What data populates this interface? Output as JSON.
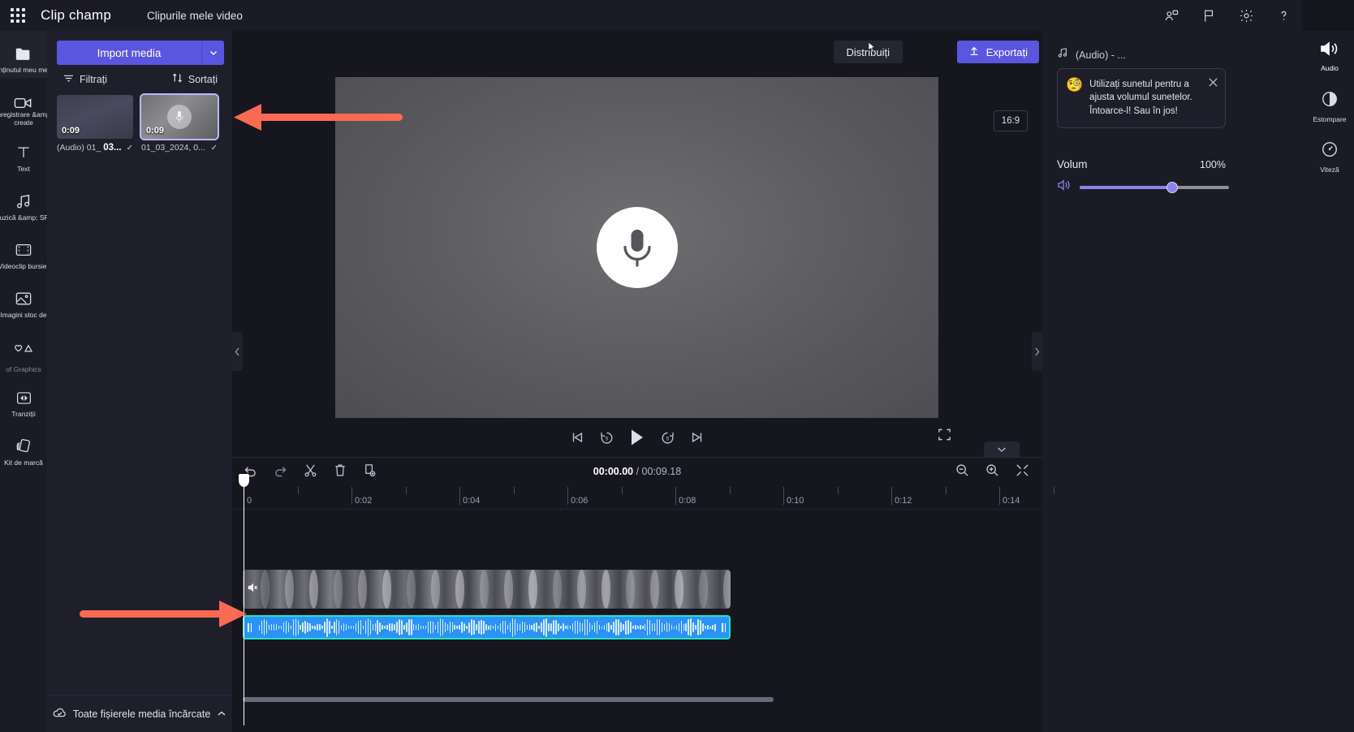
{
  "topbar": {
    "waffle_icon": "app-launcher-icon",
    "brand": "Clip champ",
    "project_name": "Clipurile mele video",
    "icons": [
      {
        "name": "share-person-icon",
        "glyph": "person-share"
      },
      {
        "name": "flag-feedback-icon",
        "glyph": "flag"
      },
      {
        "name": "settings-gear-icon",
        "glyph": "gear"
      },
      {
        "name": "help-question-icon",
        "glyph": "?"
      }
    ]
  },
  "sidebar": {
    "items": [
      {
        "label": "Conținutul meu media",
        "icon": "folder-icon",
        "active": true
      },
      {
        "label": "Înregistrare &amp;\ncreate",
        "icon": "video-camera-icon",
        "active": false
      },
      {
        "label": "Text",
        "icon": "text-t-icon",
        "active": false
      },
      {
        "label": "Muzică &amp; SFX",
        "icon": "music-note-icon",
        "active": false
      },
      {
        "label": "Videoclip bursier",
        "icon": "film-strip-icon",
        "active": false
      },
      {
        "label": "Imagini stoc de",
        "icon": "image-icon",
        "active": false
      },
      {
        "label": "of\nGraphics",
        "icon": "heart-triangle-icon",
        "active": false
      },
      {
        "label": "Tranziții",
        "icon": "transition-icon",
        "active": false
      },
      {
        "label": "Kit de marcă",
        "icon": "brand-cards-icon",
        "active": false
      }
    ]
  },
  "media_panel": {
    "import_label": "Import media",
    "import_caret_icon": "chevron-down-icon",
    "filter_label": "Filtrați",
    "filter_icon": "filter-icon",
    "sort_label": "Sortați",
    "sort_icon": "sort-arrows-icon",
    "items": [
      {
        "duration": "0:09",
        "name_prefix": "(Audio) 01_",
        "name_bold": "03...",
        "kind": "audio",
        "selected": true
      },
      {
        "duration": "0:09",
        "name_prefix": "01_03_2024, 0...",
        "name_bold": "",
        "kind": "video",
        "selected": false
      }
    ],
    "all_media_label": "Toate fișierele media încărcate",
    "all_media_icon": "cloud-check-icon",
    "all_media_caret": "chevron-up-icon"
  },
  "stage": {
    "share_label": "Distribuiți",
    "export_label": "Exportați",
    "export_icon": "upload-icon",
    "aspect_ratio": "16:9",
    "preview_icon": "microphone-icon",
    "transport": [
      {
        "name": "skip-to-start-button",
        "glyph": "|<"
      },
      {
        "name": "rewind-5s-button",
        "glyph": "5"
      },
      {
        "name": "play-button",
        "glyph": "play"
      },
      {
        "name": "forward-5s-button",
        "glyph": "5"
      },
      {
        "name": "skip-to-end-button",
        "glyph": ">|"
      }
    ],
    "fullscreen_icon": "fullscreen-icon",
    "collapse_left_icon": "chevron-left-icon",
    "collapse_right_icon": "chevron-right-icon",
    "panel_toggle_icon": "chevron-down-icon"
  },
  "right_panel": {
    "clip_icon": "music-note-icon",
    "clip_title": "(Audio) - ...",
    "tip": {
      "emoji": "🧐",
      "text": "Utilizați sunetul pentru a ajusta volumul sunetelor. Întoarce-l! Sau în jos!",
      "close_icon": "close-icon"
    },
    "volume_label": "Volum",
    "volume_value": "100%",
    "volume_icon": "speaker-icon",
    "slider_percent": 62,
    "tabs": [
      {
        "label": "Audio",
        "icon": "speaker-loud-icon",
        "active": true
      },
      {
        "label": "Estompare",
        "icon": "fade-circle-icon",
        "active": false
      },
      {
        "label": "Viteză",
        "icon": "speedometer-icon",
        "active": false
      }
    ]
  },
  "timeline": {
    "tools": [
      {
        "name": "undo-button",
        "icon": "undo-icon"
      },
      {
        "name": "redo-button",
        "icon": "redo-icon"
      },
      {
        "name": "split-button",
        "icon": "scissors-icon"
      },
      {
        "name": "delete-button",
        "icon": "trash-icon"
      },
      {
        "name": "duplicate-button",
        "icon": "duplicate-icon"
      }
    ],
    "current_time": "00:00.00",
    "separator": " / ",
    "total_time": "00:09.18",
    "right_tools": [
      {
        "name": "zoom-out-button",
        "icon": "zoom-out-icon"
      },
      {
        "name": "zoom-in-button",
        "icon": "zoom-in-icon"
      },
      {
        "name": "fit-timeline-button",
        "icon": "fit-icon"
      }
    ],
    "ruler_labels": [
      "0",
      "0:02",
      "0:04",
      "0:06",
      "0:08",
      "0:10",
      "0:12",
      "0:14"
    ],
    "video_track": {
      "mute_icon": "speaker-mute-icon"
    },
    "audio_track": {
      "selected": true
    }
  },
  "annotations": {
    "arrow_color": "#fa6a52",
    "arrows": [
      {
        "name": "arrow-to-media-item",
        "direction": "left"
      },
      {
        "name": "arrow-to-audio-clip",
        "direction": "right"
      }
    ]
  }
}
